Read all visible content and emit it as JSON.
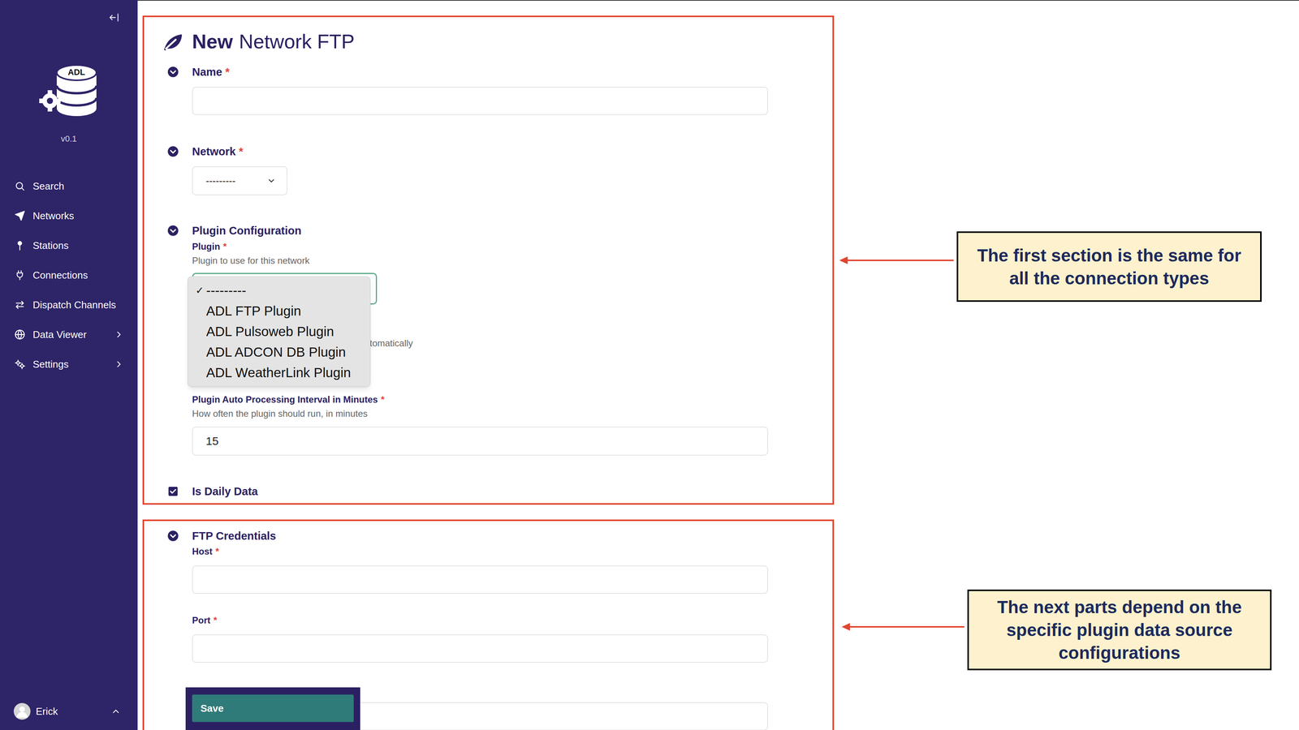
{
  "sidebar": {
    "logo_text": "ADL",
    "version": "v0.1",
    "items": [
      {
        "label": "Search",
        "kind": "link"
      },
      {
        "label": "Networks",
        "kind": "link"
      },
      {
        "label": "Stations",
        "kind": "link"
      },
      {
        "label": "Connections",
        "kind": "link"
      },
      {
        "label": "Dispatch Channels",
        "kind": "link"
      },
      {
        "label": "Data Viewer",
        "kind": "group"
      },
      {
        "label": "Settings",
        "kind": "group"
      }
    ],
    "user": {
      "name": "Erick"
    }
  },
  "form": {
    "title_strong": "New",
    "title": "Network FTP",
    "required_mark": "*",
    "name": {
      "label": "Name",
      "required": true,
      "value": ""
    },
    "network": {
      "label": "Network",
      "required": true,
      "value": "---------"
    },
    "plugin_configuration": {
      "label": "Plugin Configuration",
      "plugin": {
        "label": "Plugin",
        "required": true,
        "help": "Plugin to use for this network",
        "focused": true,
        "menu": {
          "open": true,
          "check_glyph": "✓",
          "options": [
            {
              "label": "---------",
              "selected": true
            },
            {
              "label": "ADL FTP Plugin",
              "selected": false
            },
            {
              "label": "ADL Pulsoweb Plugin",
              "selected": false
            },
            {
              "label": "ADL ADCON DB Plugin",
              "selected": false
            },
            {
              "label": "ADL WeatherLink Plugin",
              "selected": false
            }
          ]
        }
      },
      "covered_help": "tomatically",
      "interval": {
        "label": "Plugin Auto Processing Interval in Minutes",
        "required": true,
        "help": "How often the plugin should run, in minutes",
        "value": "15"
      }
    },
    "is_daily_data": {
      "label": "Is Daily Data",
      "checked": true
    },
    "ftp_credentials": {
      "label": "FTP Credentials",
      "fields": [
        {
          "label": "Host",
          "required": true,
          "value": ""
        },
        {
          "label": "Port",
          "required": true,
          "value": ""
        }
      ],
      "covered_field": {
        "value": ""
      }
    },
    "save_button": "Save"
  },
  "annotations": [
    {
      "text": "The first section is the same for all the connection types"
    },
    {
      "text": "The next parts depend on the specific plugin data source configurations"
    }
  ]
}
